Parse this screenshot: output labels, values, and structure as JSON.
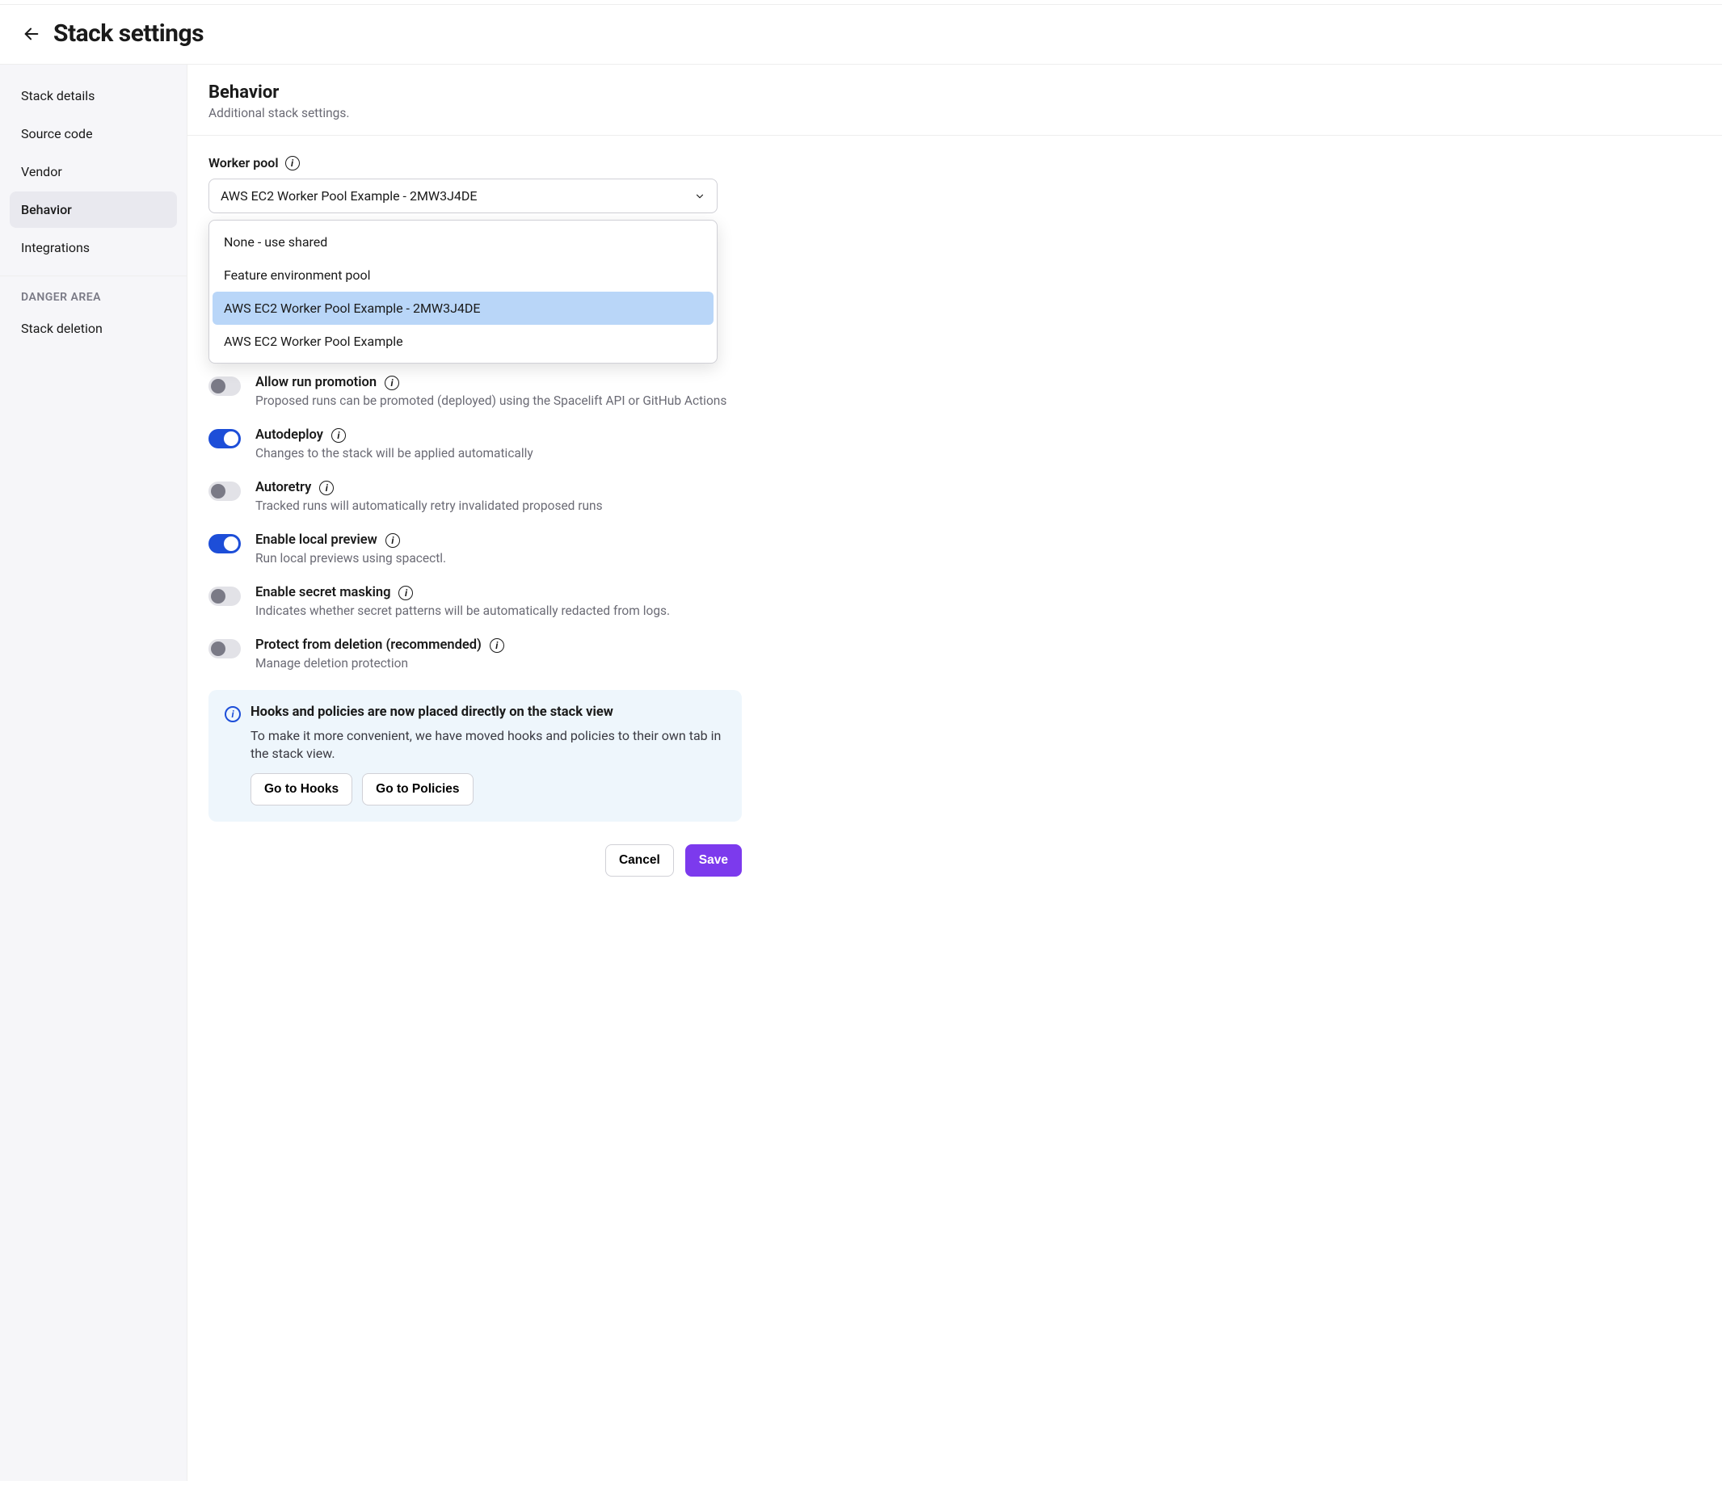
{
  "header": {
    "title": "Stack settings"
  },
  "sidebar": {
    "items": [
      {
        "label": "Stack details"
      },
      {
        "label": "Source code"
      },
      {
        "label": "Vendor"
      },
      {
        "label": "Behavior"
      },
      {
        "label": "Integrations"
      }
    ],
    "danger_label": "DANGER AREA",
    "danger_items": [
      {
        "label": "Stack deletion"
      }
    ]
  },
  "main": {
    "title": "Behavior",
    "subtitle": "Additional stack settings.",
    "worker_pool": {
      "label": "Worker pool",
      "value": "AWS EC2 Worker Pool Example - 2MW3J4DE",
      "options": [
        "None - use shared",
        "Feature environment pool",
        "AWS EC2 Worker Pool Example - 2MW3J4DE",
        "AWS EC2 Worker Pool Example"
      ]
    },
    "toggles": [
      {
        "title": "Allow run promotion",
        "desc": "Proposed runs can be promoted (deployed) using the Spacelift API or GitHub Actions",
        "on": false
      },
      {
        "title": "Autodeploy",
        "desc": "Changes to the stack will be applied automatically",
        "on": true
      },
      {
        "title": "Autoretry",
        "desc": "Tracked runs will automatically retry invalidated proposed runs",
        "on": false
      },
      {
        "title": "Enable local preview",
        "desc": "Run local previews using spacectl.",
        "on": true
      },
      {
        "title": "Enable secret masking",
        "desc": "Indicates whether secret patterns will be automatically redacted from logs.",
        "on": false
      },
      {
        "title": "Protect from deletion (recommended)",
        "desc": "Manage deletion protection",
        "on": false
      }
    ],
    "banner": {
      "title": "Hooks and policies are now placed directly on the stack view",
      "body": "To make it more convenient, we have moved hooks and policies to their own tab in the stack view.",
      "hooks_btn": "Go to Hooks",
      "policies_btn": "Go to Policies"
    },
    "footer": {
      "cancel": "Cancel",
      "save": "Save"
    }
  }
}
